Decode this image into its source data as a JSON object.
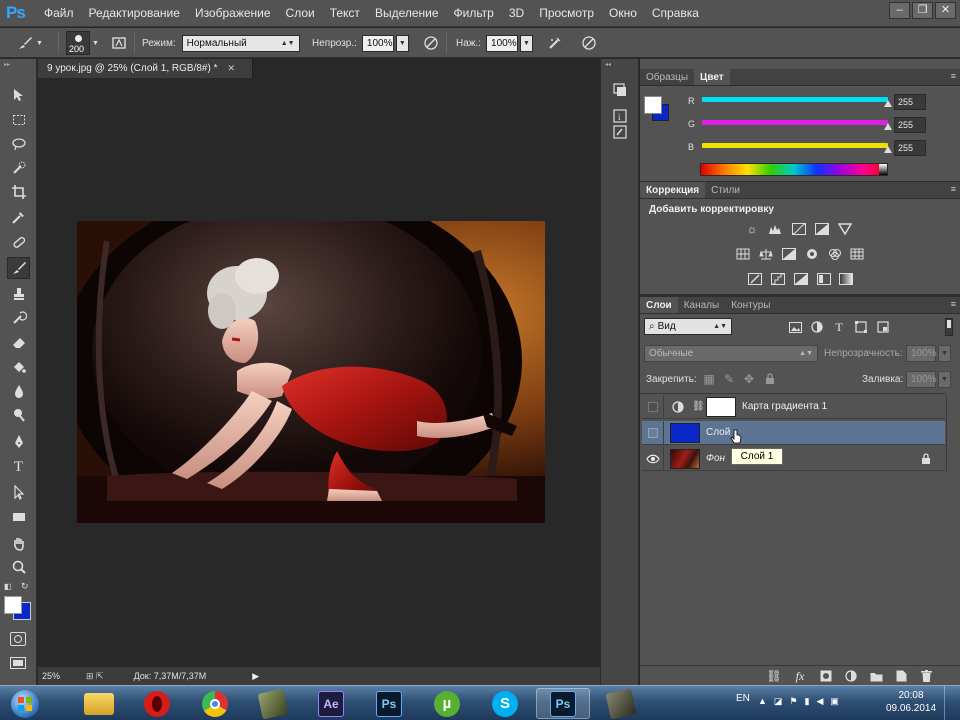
{
  "app": {
    "logo": "Ps"
  },
  "menu": [
    "Файл",
    "Редактирование",
    "Изображение",
    "Слои",
    "Текст",
    "Выделение",
    "Фильтр",
    "3D",
    "Просмотр",
    "Окно",
    "Справка"
  ],
  "options_bar": {
    "brush_size": "200",
    "mode_label": "Режим:",
    "mode_value": "Нормальный",
    "opacity_label": "Непрозр.:",
    "opacity_value": "100%",
    "flow_label": "Наж.:",
    "flow_value": "100%"
  },
  "document": {
    "tab_title": "9 урок.jpg @ 25% (Слой 1, RGB/8#) *",
    "zoom": "25%",
    "doc_size": "Док: 7,37M/7,37M"
  },
  "color_panel": {
    "tabs": [
      "Образцы",
      "Цвет"
    ],
    "active_tab": "Цвет",
    "channels": [
      {
        "label": "R",
        "value": "255",
        "color": "#00e0f0"
      },
      {
        "label": "G",
        "value": "255",
        "color": "#e020e0"
      },
      {
        "label": "B",
        "value": "255",
        "color": "#f0e000"
      }
    ],
    "foreground_color": "#ffffff",
    "background_color": "#0a28c8"
  },
  "adjustments_panel": {
    "tabs": [
      "Коррекция",
      "Стили"
    ],
    "heading": "Добавить корректировку"
  },
  "layers_panel": {
    "tabs": [
      "Слои",
      "Каналы",
      "Контуры"
    ],
    "filter_value": "Вид",
    "blend_mode": "Обычные",
    "opacity_label": "Непрозрачность:",
    "opacity_value": "100%",
    "lock_label": "Закрепить:",
    "fill_label": "Заливка:",
    "fill_value": "100%",
    "layers": [
      {
        "name": "Карта градиента 1",
        "visible": false,
        "type": "adjustment"
      },
      {
        "name": "Слой",
        "visible": false,
        "type": "fill",
        "selected": true
      },
      {
        "name": "Фон",
        "visible": true,
        "type": "photo",
        "locked": true
      }
    ],
    "tooltip": "Слой 1"
  },
  "taskbar": {
    "lang": "EN",
    "time": "20:08",
    "date": "09.06.2014",
    "apps": [
      "Проводник",
      "Opera",
      "Chrome",
      "Photo",
      "Ae",
      "Ps",
      "uTorrent",
      "Skype",
      "Ps",
      "Photo"
    ]
  }
}
